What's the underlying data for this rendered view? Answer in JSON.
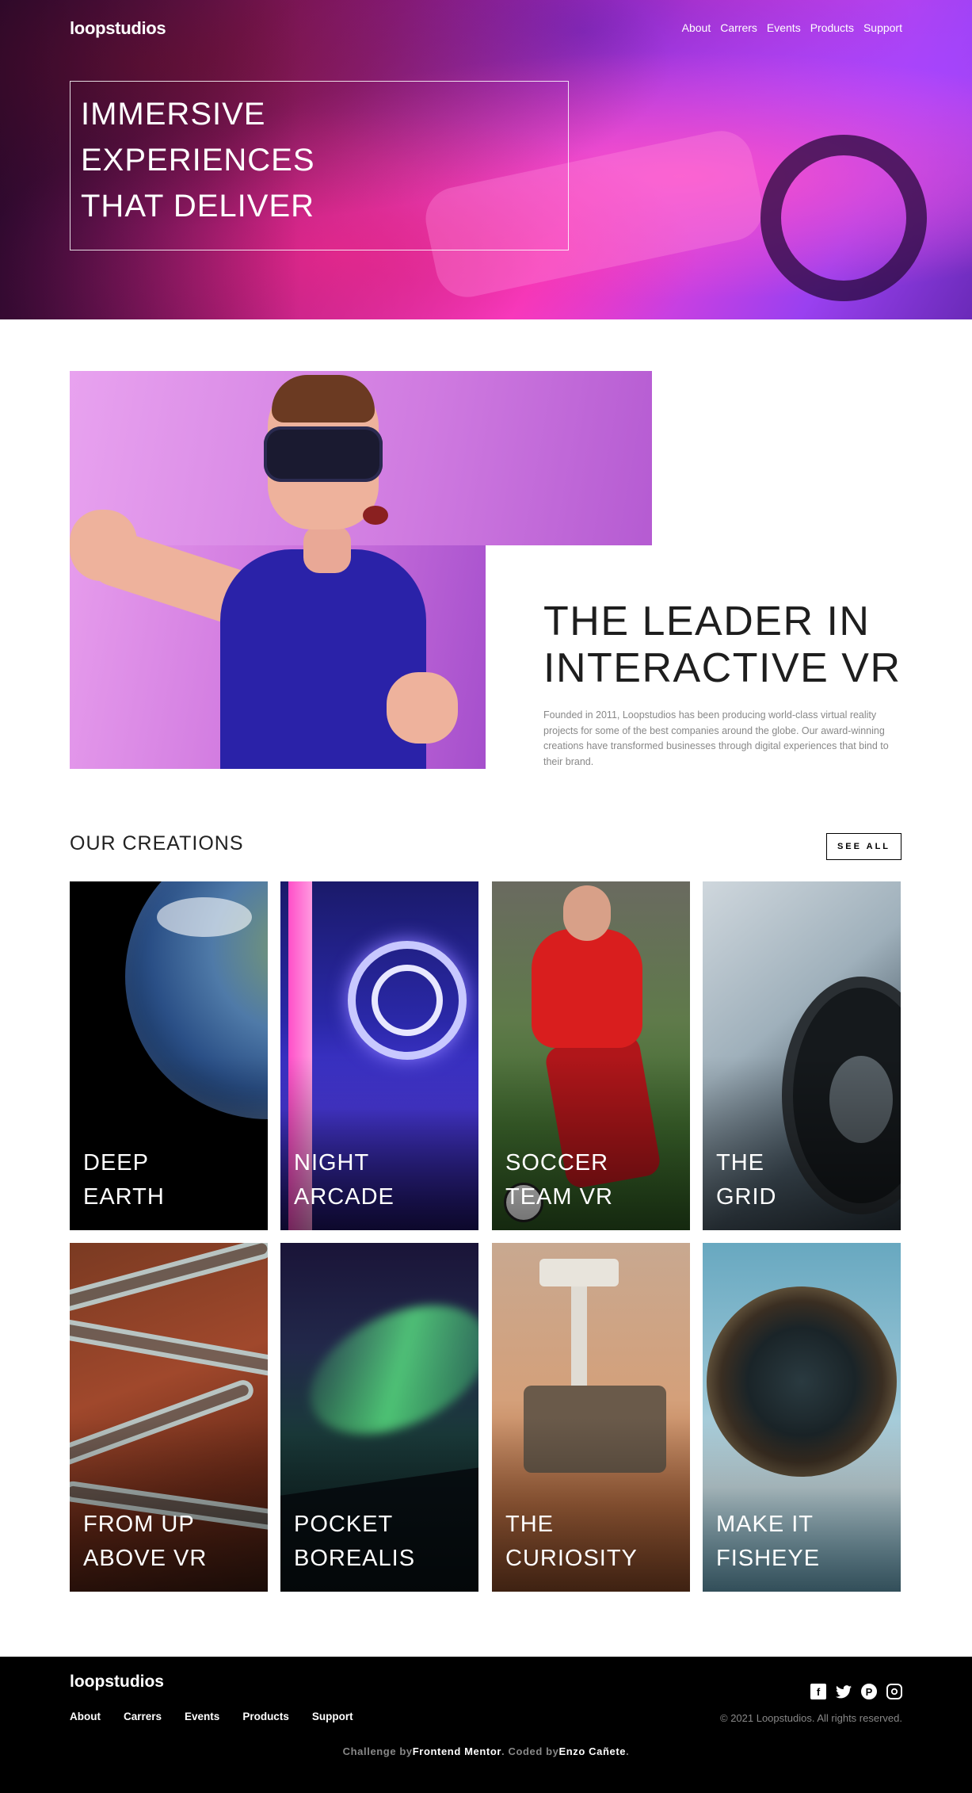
{
  "header": {
    "logo": "loopstudios",
    "nav": [
      "About",
      "Carrers",
      "Events",
      "Products",
      "Support"
    ]
  },
  "hero": {
    "lines": [
      "IMMERSIVE",
      "EXPERIENCES",
      "THAT DELIVER"
    ]
  },
  "interactive": {
    "title": "THE LEADER IN INTERACTIVE VR",
    "text": "Founded in 2011, Loopstudios has been producing world-class virtual reality projects for some of the best companies around the globe. Our award-winning creations have transformed businesses through digital experiences that bind to their brand."
  },
  "creations": {
    "title": "OUR CREATIONS",
    "see_all": "SEE ALL",
    "cards": [
      {
        "label": "DEEP\nEARTH"
      },
      {
        "label": "NIGHT\nARCADE"
      },
      {
        "label": "SOCCER\nTEAM VR"
      },
      {
        "label": "THE\nGRID"
      },
      {
        "label": "FROM UP\nABOVE VR"
      },
      {
        "label": "POCKET\nBOREALIS"
      },
      {
        "label": "THE\nCURIOSITY"
      },
      {
        "label": "MAKE IT\nFISHEYE"
      }
    ]
  },
  "footer": {
    "logo": "loopstudios",
    "nav": [
      "About",
      "Carrers",
      "Events",
      "Products",
      "Support"
    ],
    "social": [
      "facebook-icon",
      "twitter-icon",
      "pinterest-icon",
      "instagram-icon"
    ],
    "copyright": "© 2021 Loopstudios. All rights reserved.",
    "attribution": {
      "prefix": "Challenge by",
      "mentor": "Frontend Mentor",
      "middle": ". Coded by",
      "author": "Enzo Cañete",
      "suffix": "."
    }
  }
}
